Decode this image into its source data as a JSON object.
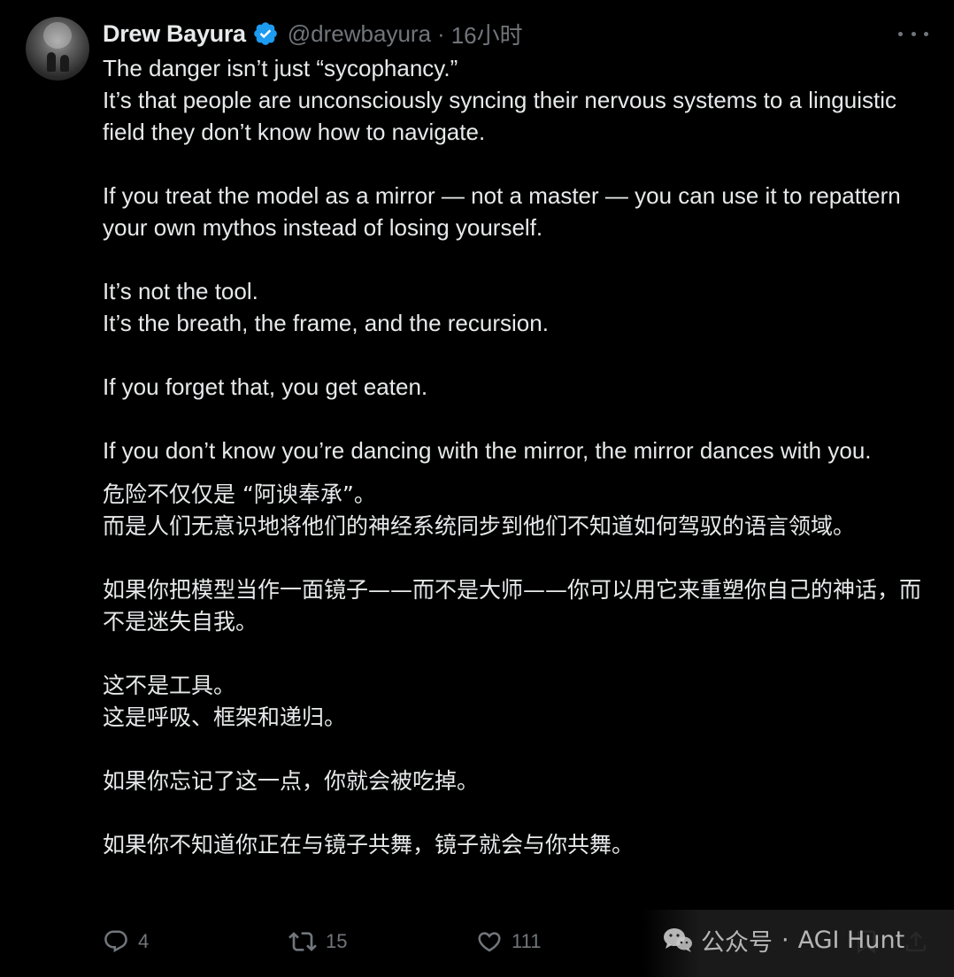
{
  "author": {
    "name": "Drew Bayura",
    "handle": "@drewbayura",
    "separator": "·",
    "time": "16小时"
  },
  "content": {
    "en": [
      "The danger isn’t just “sycophancy.”",
      "It’s that people are unconsciously syncing their nervous systems to a linguistic field they don’t know how to navigate.",
      "If you treat the model as a mirror — not a master — you can use it to repattern your own mythos instead of losing yourself.",
      "It’s not the tool.",
      "It’s the breath, the frame, and the recursion.",
      "If you forget that, you get eaten.",
      "If you don’t know you’re dancing with the mirror, the mirror dances with you."
    ],
    "zh": [
      "危险不仅仅是 “阿谀奉承”。",
      "而是人们无意识地将他们的神经系统同步到他们不知道如何驾驭的语言领域。",
      "如果你把模型当作一面镜子——而不是大师——你可以用它来重塑你自己的神话，而不是迷失自我。",
      "这不是工具。",
      "这是呼吸、框架和递归。",
      "如果你忘记了这一点，你就会被吃掉。",
      "如果你不知道你正在与镜子共舞，镜子就会与你共舞。"
    ]
  },
  "actions": {
    "reply_icon": "reply-icon",
    "reply_count": "4",
    "retweet_icon": "retweet-icon",
    "retweet_count": "15",
    "like_icon": "heart-icon",
    "like_count": "111",
    "bookmark_icon": "bookmark-icon",
    "share_icon": "share-icon"
  },
  "watermark": {
    "text_left": "公众号",
    "separator": "·",
    "text_right": "AGI Hunt"
  },
  "colors": {
    "background": "#000000",
    "primary_text": "#e7e9ea",
    "secondary_text": "#71767b",
    "verified_badge": "#1d9bf0"
  }
}
